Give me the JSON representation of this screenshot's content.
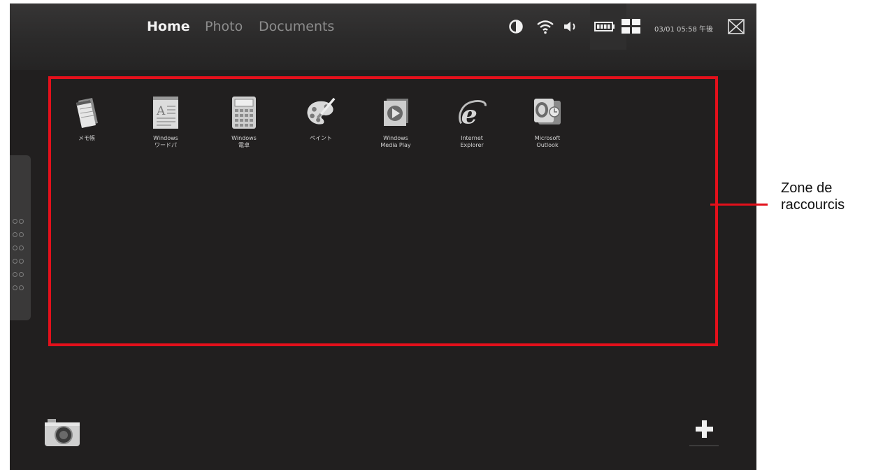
{
  "topbar": {
    "tabs": [
      {
        "label": "Home",
        "active": true
      },
      {
        "label": "Photo",
        "active": false
      },
      {
        "label": "Documents",
        "active": false
      }
    ],
    "status_icons": [
      "brightness-icon",
      "wifi-icon",
      "volume-icon",
      "battery-icon",
      "grid-view-icon"
    ],
    "datetime": "03/01 05:58 午後",
    "close_icon": "close-icon"
  },
  "shortcuts": [
    {
      "label": "メモ帳",
      "icon": "notepad-icon"
    },
    {
      "label": "Windows\nワードパ",
      "icon": "wordpad-icon"
    },
    {
      "label": "Windows\n電卓",
      "icon": "calculator-icon"
    },
    {
      "label": "ペイント",
      "icon": "paint-icon"
    },
    {
      "label": "Windows\nMedia Play",
      "icon": "media-player-icon"
    },
    {
      "label": "Internet\nExplorer",
      "icon": "internet-explorer-icon"
    },
    {
      "label": "Microsoft\nOutlook",
      "icon": "outlook-icon"
    }
  ],
  "annotation": {
    "label": "Zone de\nraccourcis",
    "color": "#e3101b"
  },
  "bottom": {
    "camera_icon": "camera-icon",
    "add_icon": "plus-icon"
  },
  "colors": {
    "background": "#211f1f",
    "highlight": "#e3101b"
  }
}
